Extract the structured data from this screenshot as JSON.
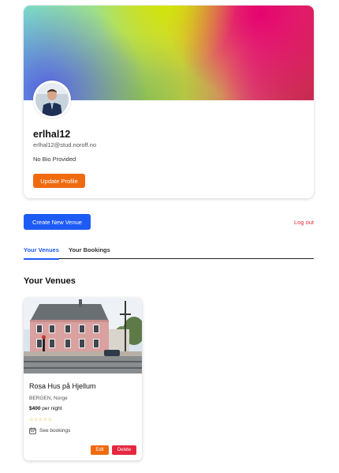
{
  "colors": {
    "primary": "#1e5bf5",
    "accent_orange": "#f06a0f",
    "danger": "#e5283f",
    "logout": "#e0303b"
  },
  "profile": {
    "banner": "gradient-banner",
    "avatar": "profile-avatar-photo",
    "name": "erlhal12",
    "email": "erlhal12@stud.noroff.no",
    "bio": "No Bio Provided",
    "update_button": "Update Profile"
  },
  "actions": {
    "create_venue": "Create New Venue",
    "logout": "Log out"
  },
  "tabs": [
    {
      "label": "Your Venues",
      "active": true
    },
    {
      "label": "Your Bookings",
      "active": false
    }
  ],
  "section_title": "Your Venues",
  "venues": [
    {
      "image": "pink-house-photo",
      "name": "Rosa Hus på Hjellum",
      "location": "BERGEN, Norge",
      "price": "$400",
      "price_suffix": " per night",
      "rating_stars": "☆☆☆☆☆",
      "see_bookings_icon": "calendar-icon",
      "see_bookings": "See bookings",
      "edit_button": "Edit",
      "delete_button": "Delete"
    }
  ]
}
